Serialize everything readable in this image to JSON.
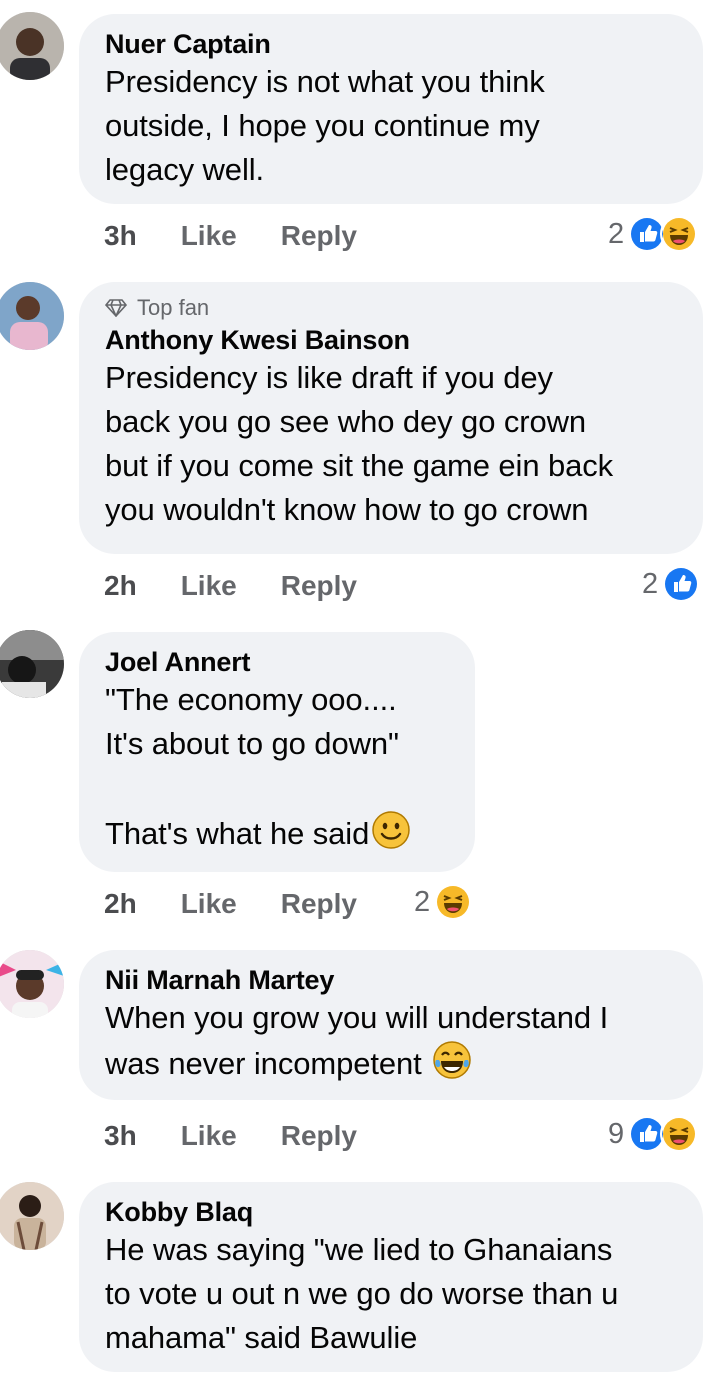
{
  "comments": [
    {
      "name": "Nuer Captain",
      "text": "Presidency is not what you think\noutside, I hope you continue my\nlegacy well.",
      "time": "3h",
      "like": "Like",
      "reply": "Reply",
      "reaction_count": "2",
      "reactions": [
        "like-icon",
        "haha-icon"
      ]
    },
    {
      "badge": "Top fan",
      "name": "Anthony Kwesi Bainson",
      "text": "Presidency is like draft if you dey\nback you go see who dey go crown\nbut if you come sit the game ein back\nyou wouldn't know how to go crown",
      "time": "2h",
      "like": "Like",
      "reply": "Reply",
      "reaction_count": "2",
      "reactions": [
        "like-icon"
      ]
    },
    {
      "name": "Joel Annert",
      "text": "\"The economy ooo....\nIt's about to go down\"\n\nThat's what he said",
      "time": "2h",
      "like": "Like",
      "reply": "Reply",
      "reaction_count": "2",
      "reactions": [
        "haha-icon"
      ]
    },
    {
      "name": "Nii Marnah Martey",
      "text": "When you grow you will understand I\nwas never incompetent",
      "time": "3h",
      "like": "Like",
      "reply": "Reply",
      "reaction_count": "9",
      "reactions": [
        "like-icon",
        "haha-icon"
      ]
    },
    {
      "name": "Kobby Blaq",
      "text": "He was saying \"we lied to Ghanaians\nto vote u out n we go do worse than u\nmahama\" said Bawulie"
    }
  ],
  "colors": {
    "bubble": "#f0f2f5",
    "like_blue": "#1877f2",
    "haha_yellow": "#f7b928",
    "meta_gray": "#65676b"
  }
}
